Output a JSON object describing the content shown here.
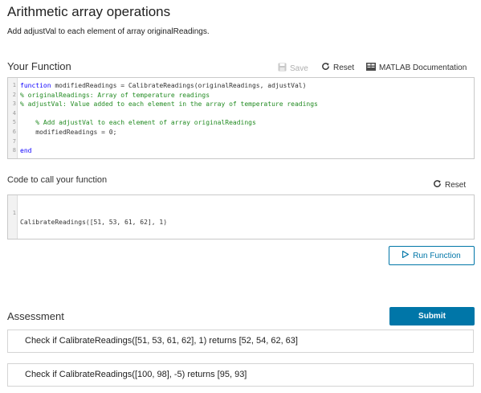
{
  "problem": {
    "title": "Arithmetic array operations",
    "description": "Add adjustVal to each element of array originalReadings."
  },
  "function_section": {
    "title": "Your Function",
    "save_label": "Save",
    "reset_label": "Reset",
    "docs_label": "MATLAB Documentation",
    "lines": [
      {
        "n": "1",
        "kw": "function",
        "text": " modifiedReadings = CalibrateReadings(originalReadings, adjustVal)",
        "type": "code"
      },
      {
        "n": "2",
        "text": "% originalReadings: Array of temperature readings",
        "type": "comment"
      },
      {
        "n": "3",
        "text": "% adjustVal: Value added to each element in the array of temperature readings",
        "type": "comment"
      },
      {
        "n": "4",
        "text": "",
        "type": "code"
      },
      {
        "n": "5",
        "text": "    % Add adjustVal to each element of array originalReadings",
        "type": "comment"
      },
      {
        "n": "6",
        "text": "    modifiedReadings = 0;",
        "type": "code"
      },
      {
        "n": "7",
        "text": "",
        "type": "code"
      },
      {
        "n": "8",
        "kw": "end",
        "text": "",
        "type": "code"
      }
    ]
  },
  "call_section": {
    "title": "Code to call your function",
    "reset_label": "Reset",
    "line_number": "1",
    "code": "CalibrateReadings([51, 53, 61, 62], 1)"
  },
  "run_label": "Run Function",
  "assessment": {
    "title": "Assessment",
    "submit_label": "Submit",
    "checks": [
      "Check if CalibrateReadings([51, 53, 61, 62], 1) returns [52, 54, 62, 63]",
      "Check if CalibrateReadings([100, 98], -5) returns [95, 93]"
    ]
  },
  "colors": {
    "accent": "#0076a8",
    "keyword": "#0e00ff",
    "comment": "#228b22"
  },
  "icons": [
    "save-icon",
    "reset-icon",
    "matlab-docs-icon",
    "play-icon"
  ]
}
